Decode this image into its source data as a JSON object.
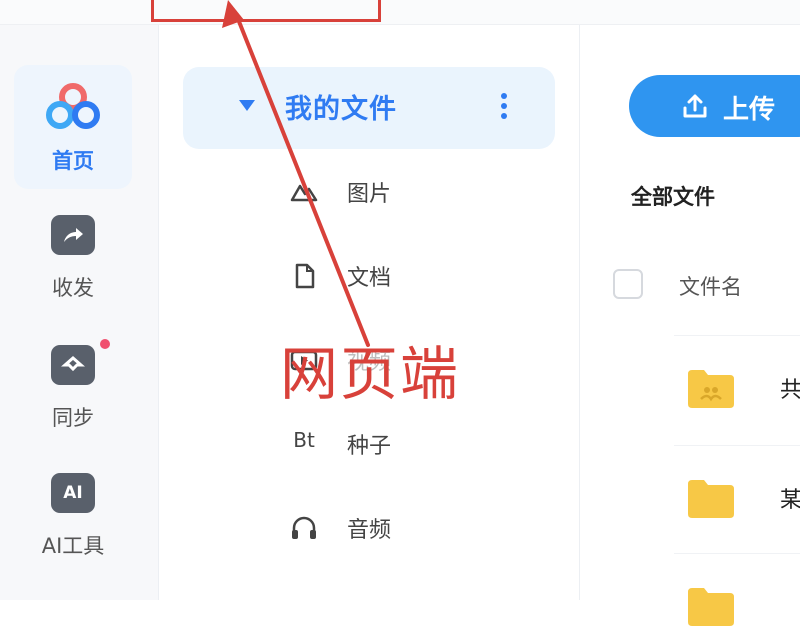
{
  "rail": {
    "items": [
      {
        "label": "首页",
        "icon": "cloud-logo-icon",
        "active": true
      },
      {
        "label": "收发",
        "icon": "share-icon"
      },
      {
        "label": "同步",
        "icon": "sync-icon"
      },
      {
        "label": "AI工具",
        "icon": "ai-tools-icon"
      }
    ]
  },
  "sidebar": {
    "my_files": "我的文件",
    "items": [
      {
        "label": "图片",
        "icon": "image-icon"
      },
      {
        "label": "文档",
        "icon": "document-icon"
      },
      {
        "label": "视频",
        "icon": "video-icon"
      },
      {
        "label": "种子",
        "icon": "torrent-icon",
        "icon_text": "Bt"
      },
      {
        "label": "音频",
        "icon": "headphones-icon"
      }
    ]
  },
  "main": {
    "upload_label": "上传",
    "breadcrumb": "全部文件",
    "column_name": "文件名",
    "files": [
      {
        "name": "共",
        "icon": "shared-folder-icon"
      },
      {
        "name": "某",
        "icon": "folder-icon"
      },
      {
        "name": "",
        "icon": "folder-icon"
      }
    ]
  },
  "annotation": {
    "text": "网页端"
  },
  "colors": {
    "accent": "#2f7bf2",
    "annotation": "#d8413a",
    "folder": "#f7c846"
  }
}
